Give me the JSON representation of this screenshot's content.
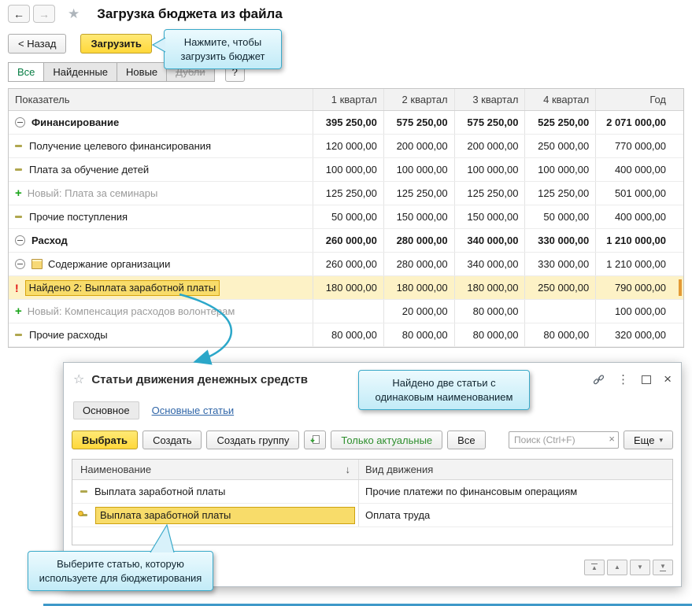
{
  "header": {
    "title": "Загрузка бюджета из файла",
    "back_button": "< Назад",
    "load_button": "Загрузить",
    "load_tooltip": "Нажмите, чтобы загрузить бюджет"
  },
  "filter_tabs": {
    "all": "Все",
    "found": "Найденные",
    "new": "Новые",
    "duplicates": "Дубли",
    "help": "?"
  },
  "budget_table": {
    "columns": [
      "Показатель",
      "1 квартал",
      "2 квартал",
      "3 квартал",
      "4 квартал",
      "Год"
    ],
    "rows": [
      {
        "label": "Финансирование",
        "level": 0,
        "bold": true,
        "icons": [
          "collapse"
        ],
        "values": [
          "395 250,00",
          "575 250,00",
          "575 250,00",
          "525 250,00",
          "2 071 000,00"
        ]
      },
      {
        "label": "Получение целевого финансирования",
        "level": 1,
        "icons": [
          "dash"
        ],
        "values": [
          "120 000,00",
          "200 000,00",
          "200 000,00",
          "250 000,00",
          "770 000,00"
        ]
      },
      {
        "label": "Плата за обучение детей",
        "level": 1,
        "icons": [
          "dash"
        ],
        "values": [
          "100 000,00",
          "100 000,00",
          "100 000,00",
          "100 000,00",
          "400 000,00"
        ]
      },
      {
        "label": "Новый: Плата за семинары",
        "level": 1,
        "gray": true,
        "icons": [
          "plus"
        ],
        "values": [
          "125 250,00",
          "125 250,00",
          "125 250,00",
          "125 250,00",
          "501 000,00"
        ]
      },
      {
        "label": "Прочие поступления",
        "level": 1,
        "icons": [
          "dash"
        ],
        "values": [
          "50 000,00",
          "150 000,00",
          "150 000,00",
          "50 000,00",
          "400 000,00"
        ]
      },
      {
        "label": "Расход",
        "level": 0,
        "bold": true,
        "icons": [
          "collapse"
        ],
        "values": [
          "260 000,00",
          "280 000,00",
          "340 000,00",
          "330 000,00",
          "1 210 000,00"
        ]
      },
      {
        "label": "Содержание организации",
        "level": 1,
        "icons": [
          "collapse",
          "folder"
        ],
        "values": [
          "260 000,00",
          "280 000,00",
          "340 000,00",
          "330 000,00",
          "1 210 000,00"
        ]
      },
      {
        "label": "Найдено 2: Выплата заработной платы",
        "level": 2,
        "highlight": true,
        "boxed": true,
        "icons": [
          "exclaim"
        ],
        "values": [
          "180 000,00",
          "180 000,00",
          "180 000,00",
          "250 000,00",
          "790 000,00"
        ]
      },
      {
        "label": "Новый: Компенсация расходов волонтерам",
        "level": 2,
        "gray": true,
        "icons": [
          "plus"
        ],
        "values": [
          "",
          "20 000,00",
          "80 000,00",
          "",
          "100 000,00"
        ]
      },
      {
        "label": "Прочие расходы",
        "level": 2,
        "icons": [
          "dash"
        ],
        "values": [
          "80 000,00",
          "80 000,00",
          "80 000,00",
          "80 000,00",
          "320 000,00"
        ]
      }
    ]
  },
  "dialog": {
    "title": "Статьи движения денежных средств",
    "tab_main": "Основное",
    "tab_link": "Основные статьи",
    "callout": "Найдено две статьи с одинаковым наименованием",
    "bottom_callout": "Выберите статью, которую используете для бюджетирования",
    "toolbar": {
      "select": "Выбрать",
      "create": "Создать",
      "create_group": "Создать группу",
      "only_actual": "Только актуальные",
      "all": "Все",
      "search_placeholder": "Поиск (Ctrl+F)",
      "more": "Еще"
    },
    "table": {
      "col_name": "Наименование",
      "col_type": "Вид движения",
      "rows": [
        {
          "name": "Выплата заработной платы",
          "type": "Прочие платежи по финансовым операциям",
          "selected": false
        },
        {
          "name": "Выплата заработной платы",
          "type": "Оплата труда",
          "selected": true
        }
      ]
    }
  },
  "icons": {
    "back_arrow": "←",
    "forward_arrow": "→",
    "favorite_star": "★",
    "dialog_star": "☆",
    "menu_dots": "⋮",
    "close": "×",
    "dropdown_arrow": "▾",
    "sort_desc": "↓",
    "clear_search": "×",
    "nav_up": "▲",
    "nav_down": "▼",
    "tree_plus": "+",
    "tree_alert": "!"
  },
  "colors": {
    "accent_yellow": "#ffd83a",
    "callout_border": "#3aa9c9",
    "callout_bg": "#d8f1fa",
    "highlight_row": "#fdf2c6",
    "selected_cell": "#f8dc6a",
    "green": "#1ba51b",
    "alert_red": "#e01010",
    "link_blue": "#3066a8"
  }
}
